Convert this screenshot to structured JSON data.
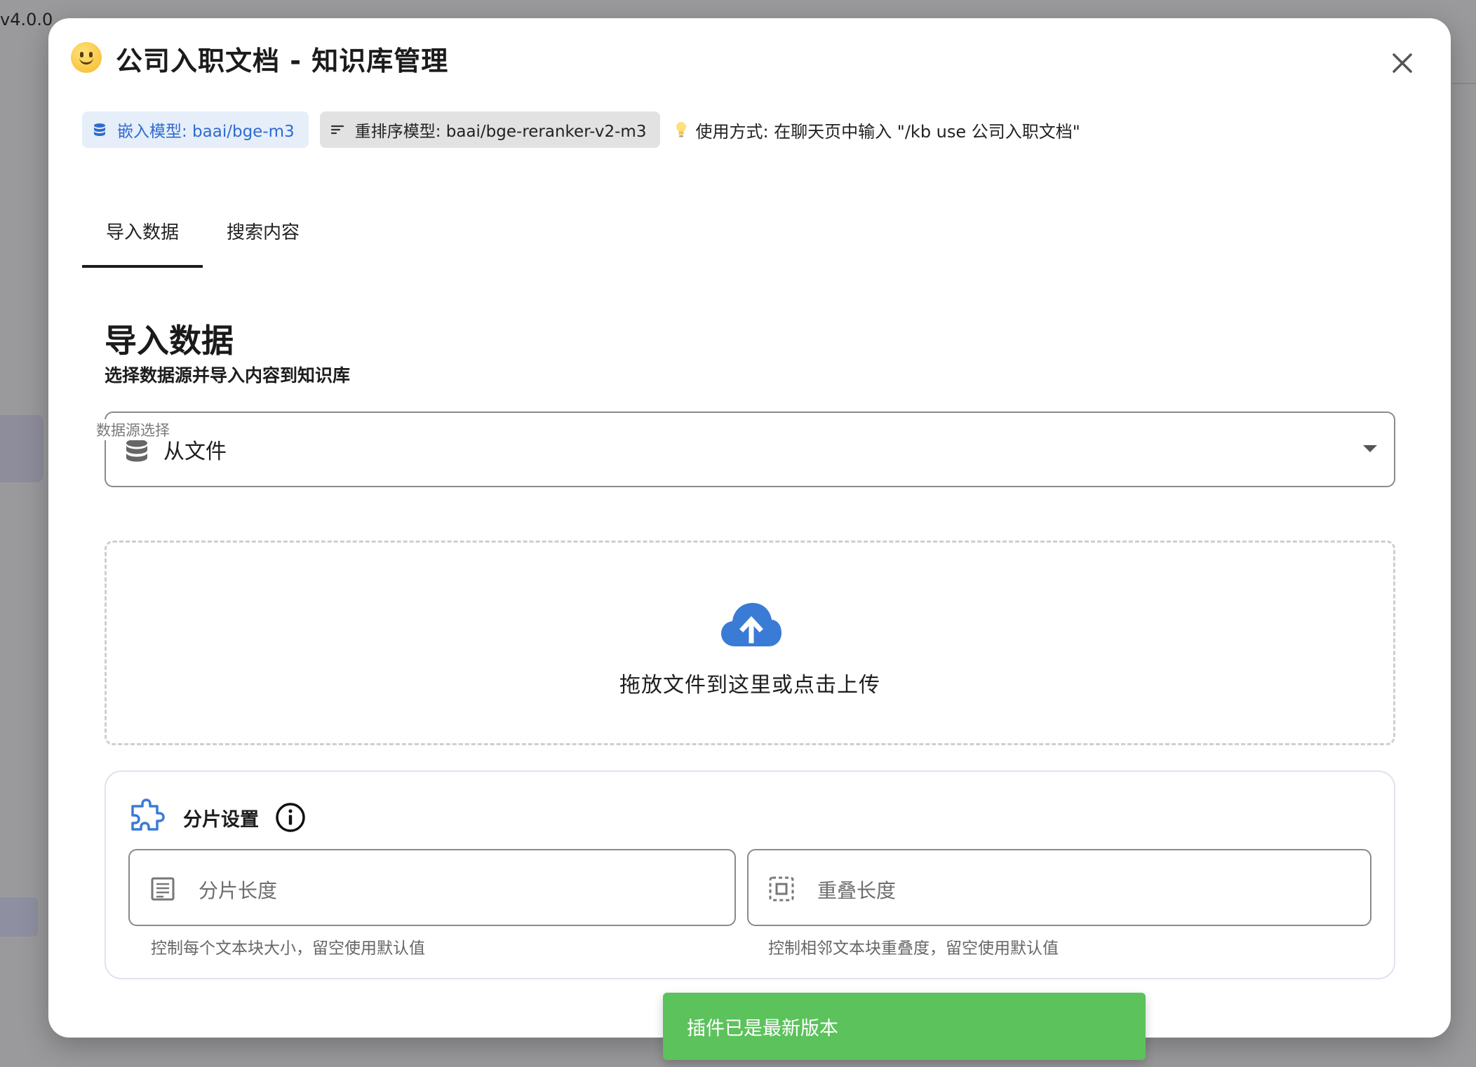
{
  "background": {
    "version": "v4.0.0"
  },
  "dialog": {
    "title": "公司入职文档 - 知识库管理",
    "chips": {
      "embed_label": "嵌入模型: baai/bge-m3",
      "rerank_label": "重排序模型: baai/bge-reranker-v2-m3"
    },
    "usage_text": "使用方式: 在聊天页中输入 \"/kb use 公司入职文档\"",
    "tabs": [
      {
        "label": "导入数据",
        "active": true
      },
      {
        "label": "搜索内容",
        "active": false
      }
    ],
    "import": {
      "title": "导入数据",
      "subtitle": "选择数据源并导入内容到知识库",
      "source_select": {
        "legend": "数据源选择",
        "value": "从文件"
      },
      "dropzone_text": "拖放文件到这里或点击上传",
      "chunk": {
        "title": "分片设置",
        "length_placeholder": "分片长度",
        "length_helper": "控制每个文本块大小，留空使用默认值",
        "overlap_placeholder": "重叠长度",
        "overlap_helper": "控制相邻文本块重叠度，留空使用默认值"
      }
    }
  },
  "toast": {
    "message": "插件已是最新版本"
  },
  "colors": {
    "accent_blue": "#3a7bd5",
    "toast_green": "#5cc25c",
    "embed_chip_bg": "#e6eef9"
  }
}
